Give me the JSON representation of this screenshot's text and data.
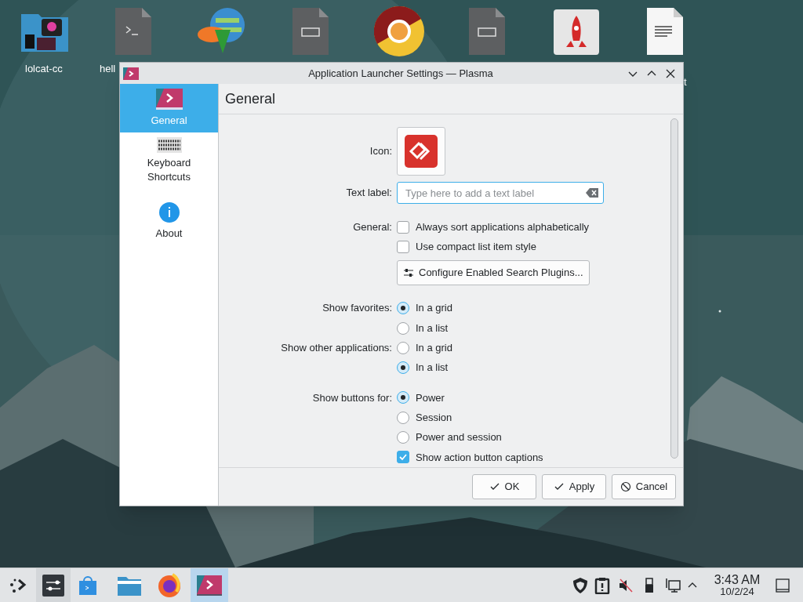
{
  "desktop": {
    "labels": [
      "lolcat-cc",
      "hell",
      "t"
    ]
  },
  "window": {
    "title": "Application Launcher Settings — Plasma",
    "sidebar": {
      "items": [
        {
          "label": "General",
          "selected": true
        },
        {
          "label": "Keyboard Shortcuts",
          "selected": false
        },
        {
          "label": "About",
          "selected": false
        }
      ]
    },
    "page_title": "General",
    "icon_row": {
      "label": "Icon:"
    },
    "text_label": {
      "label": "Text label:",
      "placeholder": "Type here to add a text label"
    },
    "general": {
      "label": "General:",
      "checkboxes": [
        {
          "label": "Always sort applications alphabetically",
          "checked": false
        },
        {
          "label": "Use compact list item style",
          "checked": false
        }
      ],
      "button": "Configure Enabled Search Plugins..."
    },
    "radio_groups": [
      {
        "label": "Show favorites:",
        "options": [
          {
            "label": "In a grid",
            "selected": true
          },
          {
            "label": "In a list",
            "selected": false
          }
        ]
      },
      {
        "label": "Show other applications:",
        "options": [
          {
            "label": "In a grid",
            "selected": false
          },
          {
            "label": "In a list",
            "selected": true
          }
        ]
      },
      {
        "label": "Show buttons for:",
        "options": [
          {
            "label": "Power",
            "selected": true
          },
          {
            "label": "Session",
            "selected": false
          },
          {
            "label": "Power and session",
            "selected": false
          }
        ]
      }
    ],
    "captions": {
      "label": "Show action button captions",
      "checked": true
    },
    "buttons": [
      {
        "kind": "ok",
        "label": "OK"
      },
      {
        "kind": "apply",
        "label": "Apply"
      },
      {
        "kind": "cancel",
        "label": "Cancel"
      }
    ]
  },
  "taskbar": {
    "time": "3:43 AM",
    "date": "10/2/24"
  }
}
